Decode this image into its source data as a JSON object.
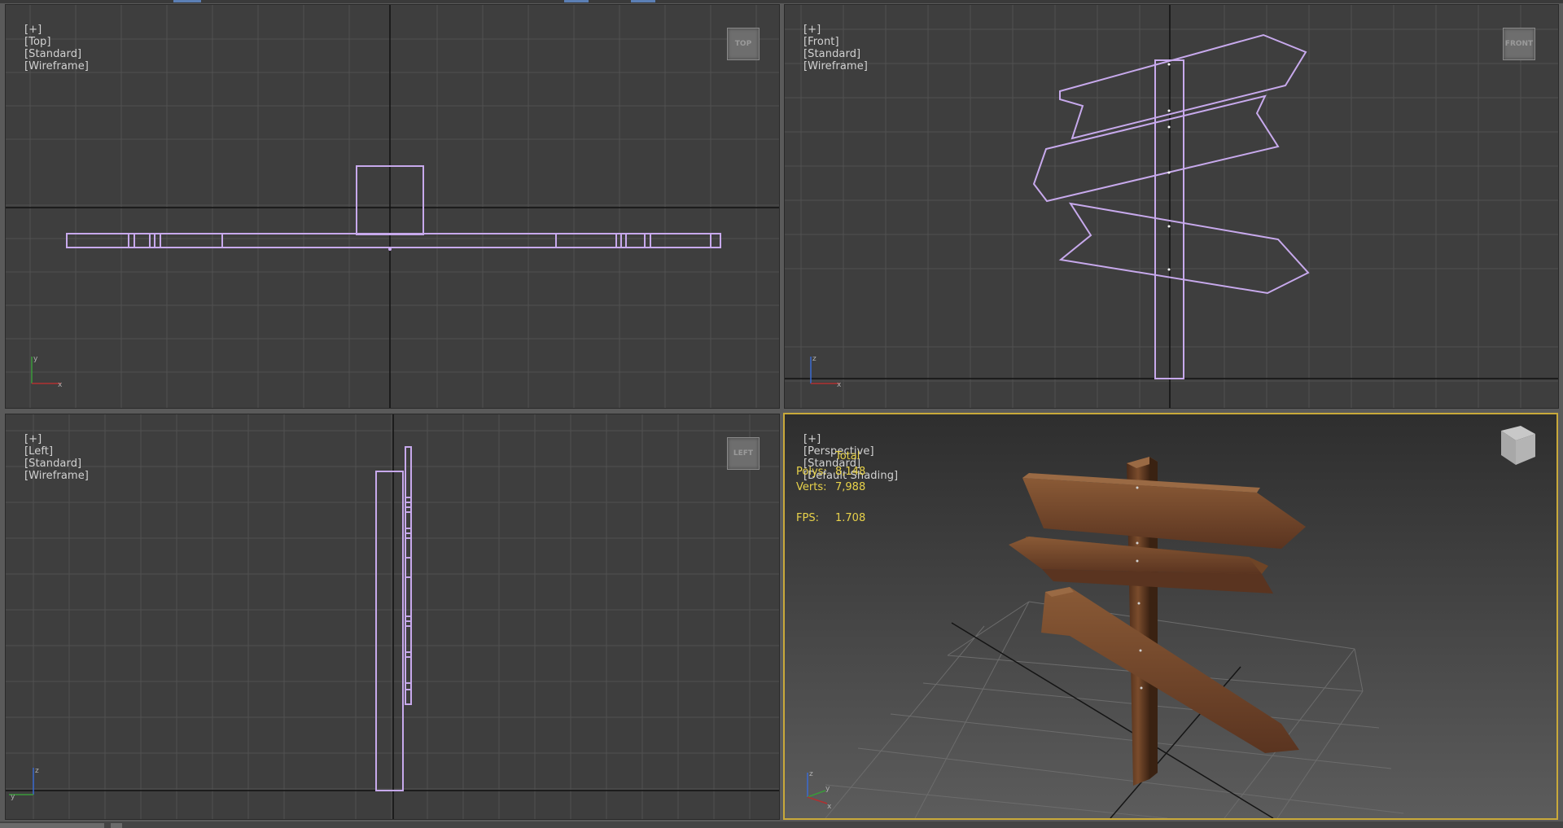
{
  "viewports": {
    "top": {
      "labels": [
        "[+]",
        "[Top]",
        "[Standard]",
        "[Wireframe]"
      ],
      "viewcube": "TOP",
      "axes": [
        "y",
        "x"
      ]
    },
    "front": {
      "labels": [
        "[+]",
        "[Front]",
        "[Standard]",
        "[Wireframe]"
      ],
      "viewcube": "FRONT",
      "axes": [
        "z",
        "x"
      ]
    },
    "left": {
      "labels": [
        "[+]",
        "[Left]",
        "[Standard]",
        "[Wireframe]"
      ],
      "viewcube": "LEFT",
      "axes": [
        "z",
        "y"
      ]
    },
    "perspective": {
      "labels": [
        "[+]",
        "[Perspective]",
        "[Standard]",
        "[Default Shading]"
      ],
      "viewcube": "cube",
      "axes": [
        "z",
        "x",
        "y"
      ],
      "stats": {
        "header": "Total",
        "polys_label": "Polys:",
        "polys_value": "8,148",
        "verts_label": "Verts:",
        "verts_value": "7,988",
        "fps_label": "FPS:",
        "fps_value": "1.708"
      }
    }
  },
  "colors": {
    "wireframe": "#c7a9ec",
    "active_border": "#c9a93a",
    "stats_text": "#e8d24a",
    "wood": "#6b4226"
  }
}
